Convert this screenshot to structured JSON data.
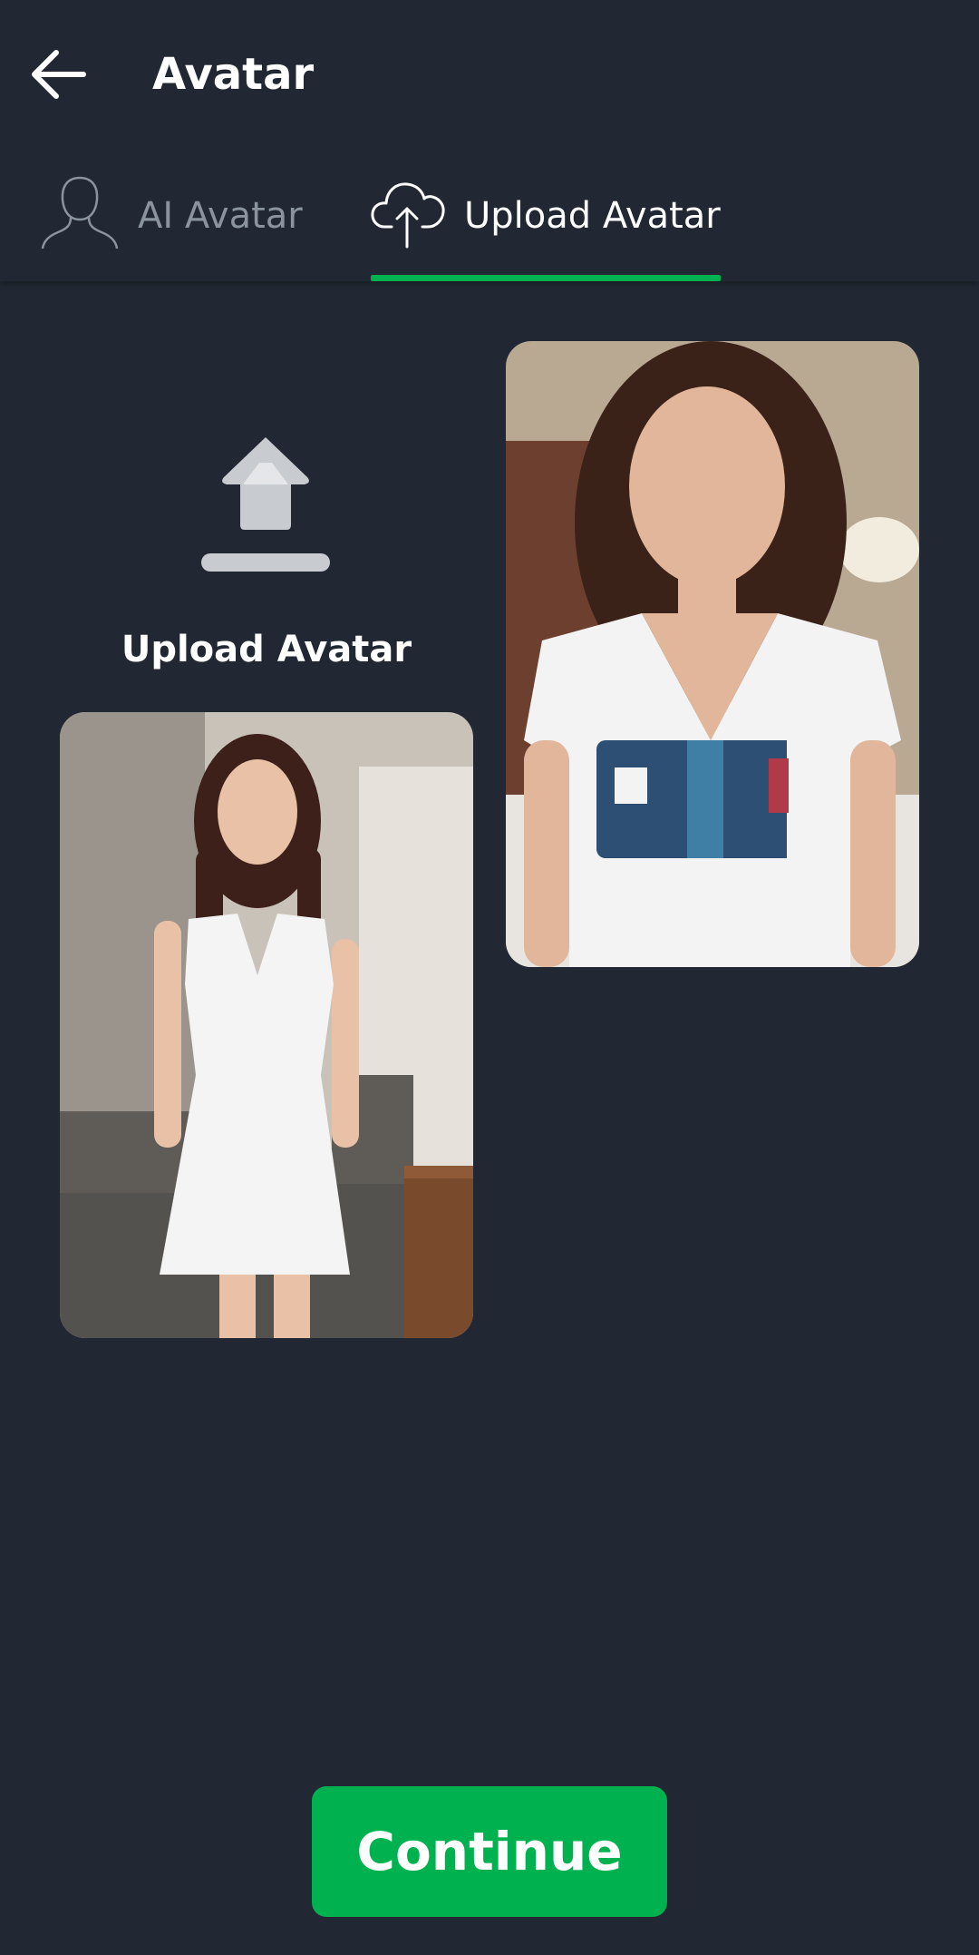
{
  "header": {
    "title": "Avatar",
    "back_icon": "arrow-left-icon"
  },
  "tabs": [
    {
      "label": "AI Avatar",
      "icon": "person-outline-icon",
      "active": false
    },
    {
      "label": "Upload Avatar",
      "icon": "cloud-upload-icon",
      "active": true
    }
  ],
  "upload_tile": {
    "label": "Upload Avatar",
    "icon": "upload-arrow-icon"
  },
  "avatars": [
    {
      "icon": "avatar-photo-white-dress"
    },
    {
      "icon": "avatar-photo-white-tshirt"
    }
  ],
  "footer": {
    "continue_label": "Continue"
  },
  "colors": {
    "background": "#212833",
    "accent": "#00b14f",
    "inactive_text": "#8a939e",
    "text": "#ffffff"
  }
}
